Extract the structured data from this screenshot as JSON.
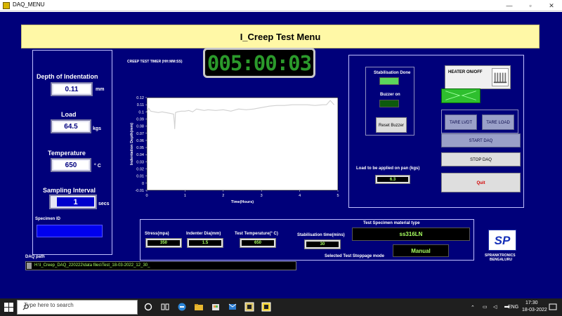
{
  "window": {
    "title": "DAQ_MENU",
    "minimize": "—",
    "restore": "▫",
    "close": "✕"
  },
  "banner": {
    "title": "I_Creep Test Menu"
  },
  "left_panel": {
    "depth": {
      "label": "Depth of Indentation",
      "value": "0.11",
      "unit": "mm"
    },
    "load": {
      "label": "Load",
      "value": "64.5",
      "unit": "kgs"
    },
    "temperature": {
      "label": "Temperature",
      "value": "650",
      "unit": "° C"
    },
    "sampling": {
      "label": "Sampling Interval",
      "value": "1",
      "unit": "secs"
    },
    "specimen_id": {
      "label": "Specimen ID",
      "value": ""
    }
  },
  "daq_path": {
    "label": "DAQ path",
    "value": "H:\\I_Creep_DAQ_220222\\data files\\Test_18-03-2022_12_30_"
  },
  "timer": {
    "label": "CREEP TEST TIMER (HH:MM:SS)",
    "value": "005:00:03"
  },
  "chart_data": {
    "type": "line",
    "xlabel": "Time(Hours)",
    "ylabel": "Indentation Depth(mm)",
    "xlim": [
      0,
      5
    ],
    "ylim": [
      -0.01,
      0.12
    ],
    "x_ticks": [
      0,
      1,
      2,
      3,
      4,
      5
    ],
    "y_ticks": [
      0.12,
      0.11,
      0.1,
      0.09,
      0.08,
      0.07,
      0.06,
      0.05,
      0.04,
      0.03,
      0.02,
      0.01,
      0,
      -0.01
    ],
    "series": [
      {
        "x": [
          0,
          0.05,
          0.1,
          0.2,
          0.3,
          0.4,
          0.5,
          0.6,
          0.7,
          0.72,
          0.73,
          0.75,
          0.8,
          0.9,
          1.0,
          1.1,
          1.2,
          1.3,
          1.4,
          1.5,
          1.6,
          1.8,
          2.0,
          2.2,
          2.4,
          2.6,
          2.8,
          3.0,
          3.2,
          3.4,
          3.6,
          3.8,
          4.0,
          4.2,
          4.4,
          4.6,
          4.7,
          4.8,
          4.9
        ],
        "y": [
          0.1,
          0.105,
          0.101,
          0.1,
          0.099,
          0.1,
          0.099,
          0.098,
          0.097,
          0.085,
          0.076,
          0.099,
          0.1,
          0.101,
          0.101,
          0.102,
          0.1,
          0.104,
          0.103,
          0.102,
          0.103,
          0.102,
          0.103,
          0.101,
          0.104,
          0.103,
          0.104,
          0.106,
          0.108,
          0.109,
          0.109,
          0.11,
          0.11,
          0.11,
          0.109,
          0.11,
          0.11,
          0.116,
          0.11
        ]
      }
    ],
    "grid": false,
    "colors": {
      "background": "#ffffff",
      "line": "#d0d0d0",
      "axes": "#000000"
    }
  },
  "status_panel": {
    "stabilisation_done": "Stabilisation Done",
    "buzzer_on": "Buzzer on",
    "reset_buzzer": "Reset Buzzer",
    "heater_on_off": "HEATER ON/OFF",
    "tare_lvdt": "TARE LVDT",
    "tare_load": "TARE LOAD",
    "start_daq": "START DAQ",
    "stop_daq": "STOP DAQ",
    "quit": "Quit",
    "load_on_pan_label": "Load to be applied on pan (kgs)",
    "load_on_pan_value": "6.3"
  },
  "params": {
    "stress": {
      "label": "Stress(mpa)",
      "value": "350"
    },
    "indenter_dia": {
      "label": "Indenter Dia(mm)",
      "value": "1.5"
    },
    "test_temperature": {
      "label": "Test Temperature(° C)",
      "value": "650"
    },
    "stabilisation_time": {
      "label": "Stabilisation time(mins)",
      "value": "30"
    },
    "material_type_label": "Test Specimen material type",
    "material_type_value": "ss316LN",
    "stoppage_mode_label": "Selected Test Stoppage mode",
    "stoppage_mode_value": "Manual"
  },
  "logo": {
    "mark": "SP",
    "name": "SPRANKTRONICS",
    "city": "BENGALURU"
  },
  "taskbar": {
    "search_placeholder": "Type here to search",
    "language": "ENG",
    "time": "17:30",
    "date": "18-03-2022"
  },
  "colors": {
    "panel_bg": "#00007a",
    "banner_bg": "#fff8a6",
    "indicator_green": "#2b9a2b",
    "quit_red": "#d40000"
  }
}
